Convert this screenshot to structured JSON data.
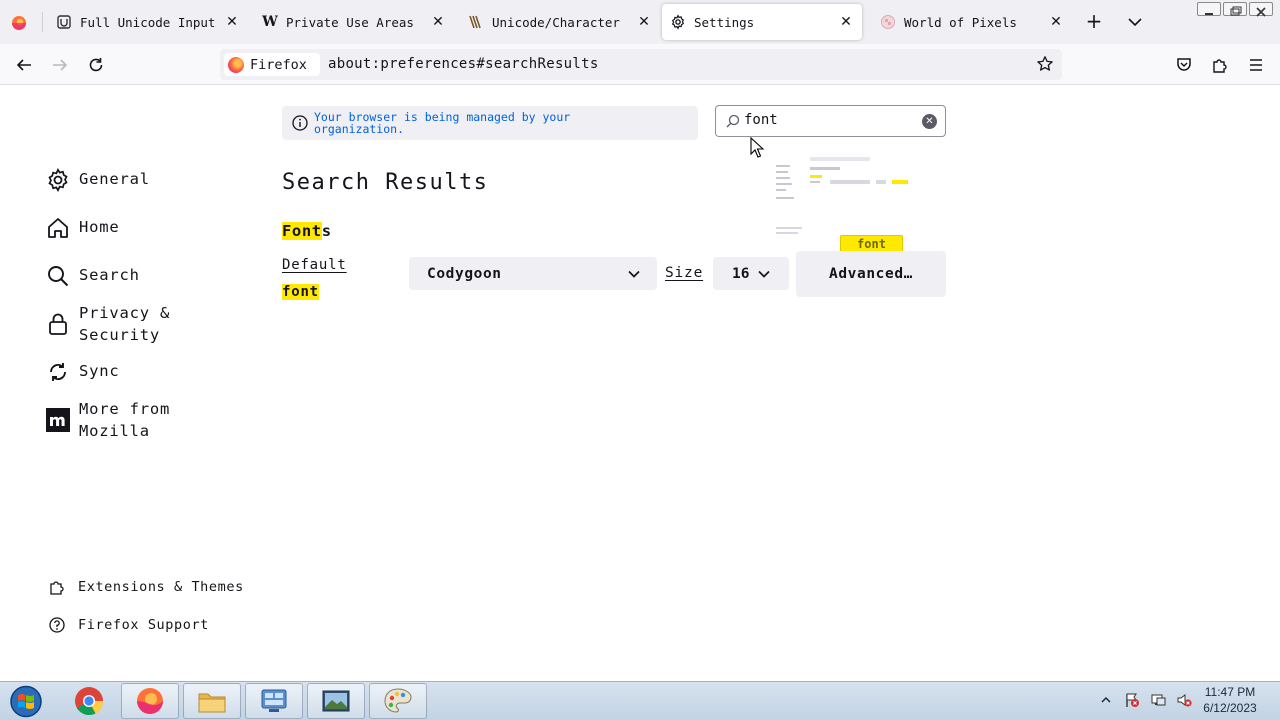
{
  "browser": {
    "tabs": [
      {
        "title": "Full Unicode Input",
        "icon": "unicode-favicon-icon"
      },
      {
        "title": "Private Use Areas",
        "icon": "wikipedia-favicon-icon"
      },
      {
        "title": "Unicode/Character",
        "icon": "wikibook-favicon-icon"
      },
      {
        "title": "Settings",
        "icon": "gear-icon",
        "active": true
      },
      {
        "title": "World of Pixels",
        "icon": "pixels-favicon-icon"
      }
    ],
    "identity_label": "Firefox",
    "url": "about:preferences#searchResults"
  },
  "sidebar": {
    "categories": [
      {
        "label": "General",
        "icon": "gear-icon"
      },
      {
        "label": "Home",
        "icon": "home-icon"
      },
      {
        "label": "Search",
        "icon": "search-icon"
      },
      {
        "label": "Privacy & Security",
        "icon": "lock-icon"
      },
      {
        "label": "Sync",
        "icon": "sync-icon"
      },
      {
        "label": "More from Mozilla",
        "icon": "mozilla-m-icon"
      }
    ],
    "footer": [
      {
        "label": "Extensions & Themes",
        "icon": "puzzle-icon"
      },
      {
        "label": "Firefox Support",
        "icon": "help-icon"
      }
    ]
  },
  "main": {
    "managed_notice": "Your browser is being managed by your organization.",
    "search_value": "font",
    "page_title": "Search Results",
    "section_title_highlight": "Font",
    "section_title_rest": "s",
    "default_label_text": "Default",
    "default_label_highlight": "font",
    "font_select_value": "Codygoon",
    "size_label": "Size",
    "size_value": "16",
    "advanced_button": "Advanced…",
    "tooltip": "font"
  },
  "taskbar": {
    "time": "11:47 PM",
    "date": "6/12/2023"
  },
  "colors": {
    "highlight": "#ffe900",
    "link_blue": "#0061e0",
    "chrome_bg": "#f0f0f4"
  }
}
